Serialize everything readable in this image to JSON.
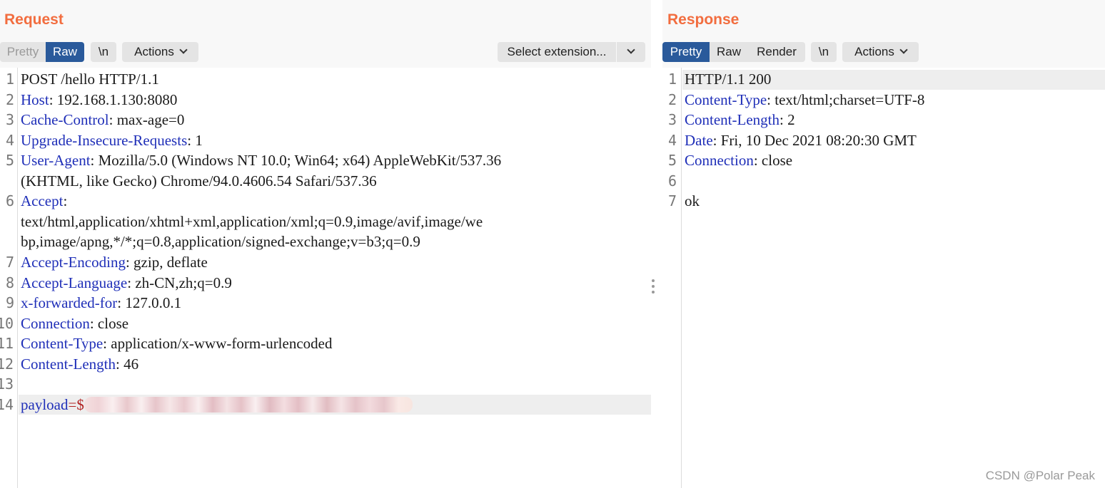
{
  "request": {
    "title": "Request",
    "toolbar": {
      "pretty_label": "Pretty",
      "raw_label": "Raw",
      "newline_label": "\\n",
      "actions_label": "Actions",
      "extension_label": "Select extension..."
    },
    "line_numbers": [
      "1",
      "2",
      "3",
      "4",
      "5",
      "6",
      "7",
      "8",
      "9",
      "10",
      "11",
      "12",
      "13",
      "14"
    ],
    "lines": {
      "l1": "POST /hello HTTP/1.1",
      "l2_key": "Host",
      "l2_val": ": 192.168.1.130:8080",
      "l3_key": "Cache-Control",
      "l3_val": ": max-age=0",
      "l4_key": "Upgrade-Insecure-Requests",
      "l4_val": ": 1",
      "l5_key": "User-Agent",
      "l5_val": ": Mozilla/5.0 (Windows NT 10.0; Win64; x64) AppleWebKit/537.36",
      "l5_cont": "(KHTML, like Gecko) Chrome/94.0.4606.54 Safari/537.36",
      "l6_key": "Accept",
      "l6_val": ":",
      "l6_cont1": "text/html,application/xhtml+xml,application/xml;q=0.9,image/avif,image/we",
      "l6_cont2": "bp,image/apng,*/*;q=0.8,application/signed-exchange;v=b3;q=0.9",
      "l7_key": "Accept-Encoding",
      "l7_val": ": gzip, deflate",
      "l8_key": "Accept-Language",
      "l8_val": ": zh-CN,zh;q=0.9",
      "l9_key": "x-forwarded-for",
      "l9_val": ": 127.0.0.1",
      "l10_key": "Connection",
      "l10_val": ": close",
      "l11_key": "Content-Type",
      "l11_val": ": application/x-www-form-urlencoded",
      "l12_key": "Content-Length",
      "l12_val": ": 46",
      "l14_key": "payload",
      "l14_eq": "=",
      "l14_sym": "$"
    }
  },
  "response": {
    "title": "Response",
    "toolbar": {
      "pretty_label": "Pretty",
      "raw_label": "Raw",
      "render_label": "Render",
      "newline_label": "\\n",
      "actions_label": "Actions"
    },
    "line_numbers": [
      "1",
      "2",
      "3",
      "4",
      "5",
      "6",
      "7"
    ],
    "lines": {
      "l1": "HTTP/1.1 200",
      "l2_key": "Content-Type",
      "l2_val": ": text/html;charset=UTF-8",
      "l3_key": "Content-Length",
      "l3_val": ": 2",
      "l4_key": "Date",
      "l4_val": ": Fri, 10 Dec 2021 08:20:30 GMT",
      "l5_key": "Connection",
      "l5_val": ": close",
      "l7": "ok"
    }
  },
  "watermark": "CSDN @Polar Peak",
  "colors": {
    "accent": "#f26d3f",
    "active_tab": "#2a5a9b",
    "header_key": "#1f2fb8"
  }
}
